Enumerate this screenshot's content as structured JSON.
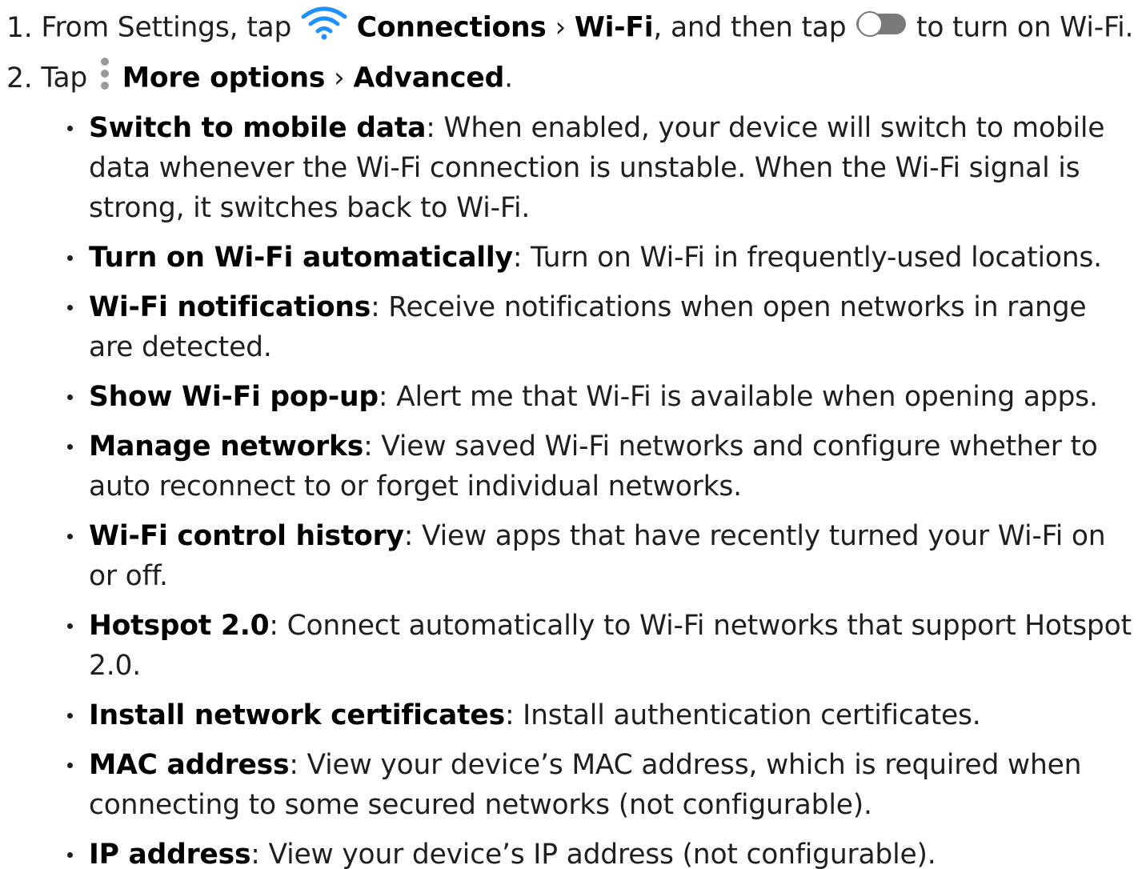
{
  "steps": [
    {
      "num": "1.",
      "t1": "From Settings, tap",
      "icon": "wifi-icon",
      "b1": "Connections",
      "sep": "›",
      "b2": "Wi-Fi",
      "t2": ", and then tap",
      "icon2": "toggle-switch-icon",
      "t3": "to turn on Wi-Fi."
    },
    {
      "num": "2.",
      "t1": "Tap",
      "icon": "more-options-icon",
      "b1": "More options",
      "sep": "›",
      "b2": "Advanced",
      "t2": "."
    }
  ],
  "bullets": [
    {
      "term": "Switch to mobile data",
      "desc": ": When enabled, your device will switch to mobile data whenever the Wi-Fi connection is unstable. When the Wi-Fi signal is strong, it switches back to Wi-Fi."
    },
    {
      "term": "Turn on Wi-Fi automatically",
      "desc": ": Turn on Wi-Fi in frequently-used locations."
    },
    {
      "term": "Wi-Fi notifications",
      "desc": ": Receive notifications when open networks in range are detected."
    },
    {
      "term": "Show Wi-Fi pop-up",
      "desc": ": Alert me that Wi-Fi is available when opening apps."
    },
    {
      "term": "Manage networks",
      "desc": ": View saved Wi-Fi networks and configure whether to auto reconnect to or forget individual networks."
    },
    {
      "term": "Wi-Fi control history",
      "desc": ": View apps that have recently turned your Wi-Fi on or off."
    },
    {
      "term": "Hotspot 2.0",
      "desc": ": Connect automatically to Wi-Fi networks that support Hotspot 2.0."
    },
    {
      "term": "Install network certificates",
      "desc": ": Install authentication certificates."
    },
    {
      "term": "MAC address",
      "desc": ": View your device’s MAC address, which is required when connecting to some secured networks (not configurable)."
    },
    {
      "term": "IP address",
      "desc": ": View your device’s IP address (not configurable)."
    }
  ],
  "colors": {
    "wifi_icon": "#1e90ff",
    "toggle_track": "#7a7a7a",
    "more_options_dots": "#9a9a9a"
  }
}
